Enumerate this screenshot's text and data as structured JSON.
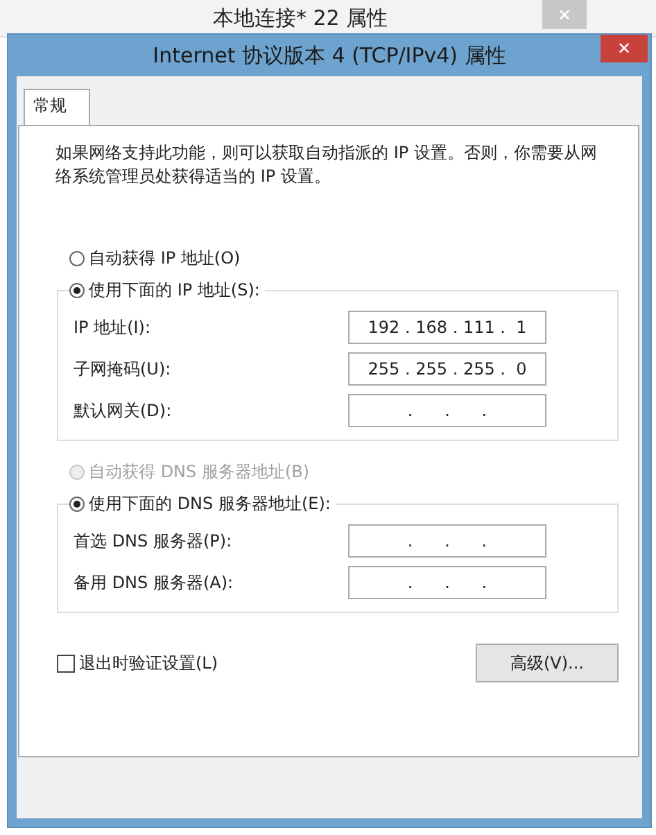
{
  "back_window": {
    "title": "本地连接* 22 属性",
    "close": "✕"
  },
  "window": {
    "title": "Internet 协议版本 4 (TCP/IPv4) 属性",
    "close": "✕"
  },
  "tabs": [
    {
      "label": "常规",
      "selected": true
    }
  ],
  "description": "如果网络支持此功能，则可以获取自动指派的 IP 设置。否则，你需要从网络系统管理员处获得适当的 IP 设置。",
  "ip_options": [
    {
      "label": "自动获得 IP 地址(O)",
      "selected": false,
      "disabled": false
    },
    {
      "label": "使用下面的 IP 地址(S):",
      "selected": true,
      "disabled": false
    }
  ],
  "ip_fields": [
    {
      "label": "IP 地址(I):",
      "value": "192 . 168 . 111 .  1"
    },
    {
      "label": "子网掩码(U):",
      "value": "255 . 255 . 255 .  0"
    },
    {
      "label": "默认网关(D):",
      "value": ".      .      ."
    }
  ],
  "dns_options": [
    {
      "label": "自动获得 DNS 服务器地址(B)",
      "selected": false,
      "disabled": true
    },
    {
      "label": "使用下面的 DNS 服务器地址(E):",
      "selected": true,
      "disabled": false
    }
  ],
  "dns_fields": [
    {
      "label": "首选 DNS 服务器(P):",
      "value": ".      .      ."
    },
    {
      "label": "备用 DNS 服务器(A):",
      "value": ".      .      ."
    }
  ],
  "validate": {
    "label": "退出时验证设置(L)",
    "checked": false
  },
  "advanced_button": "高级(V)..."
}
